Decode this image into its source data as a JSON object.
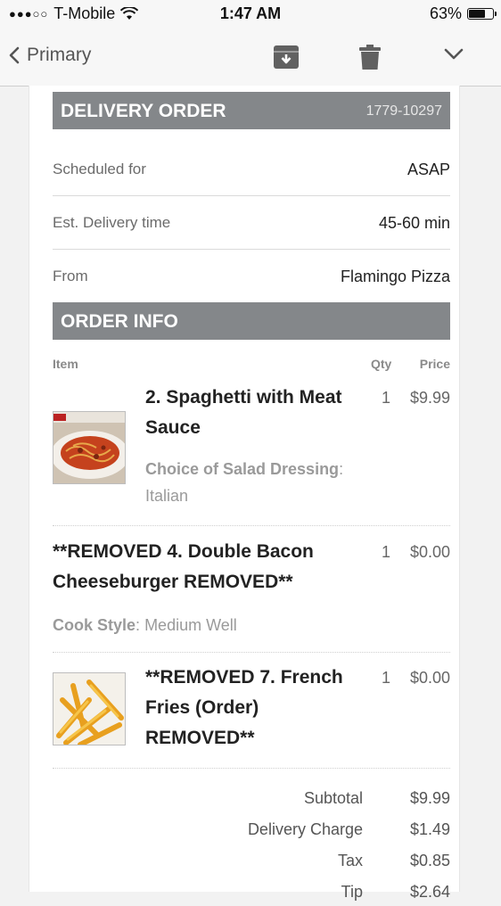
{
  "status": {
    "signal_dots": "●●●○○",
    "carrier": "T-Mobile",
    "time": "1:47 AM",
    "battery": "63%",
    "battery_level": 0.63
  },
  "nav": {
    "back_label": "Primary",
    "icons": [
      "chevron-left-icon",
      "archive-icon",
      "trash-icon",
      "chevron-down-icon"
    ]
  },
  "delivery": {
    "title": "DELIVERY ORDER",
    "order_number": "1779-10297",
    "rows": [
      {
        "label": "Scheduled for",
        "value": "ASAP"
      },
      {
        "label": "Est. Delivery time",
        "value": "45-60 min"
      },
      {
        "label": "From",
        "value": "Flamingo Pizza"
      }
    ]
  },
  "order_info": {
    "title": "ORDER INFO",
    "columns": {
      "item": "Item",
      "qty": "Qty",
      "price": "Price"
    },
    "items": [
      {
        "name_line1": "2. Spaghetti with Meat",
        "name_line2": "Sauce",
        "qty": "1",
        "price": "$9.99",
        "option_label": "Choice of Salad Dressing",
        "option_sep": ":",
        "option_value": "Italian",
        "image": "spaghetti-photo"
      },
      {
        "name_line1": "**REMOVED 4. Double Bacon",
        "name_line2": "Cheeseburger REMOVED**",
        "qty": "1",
        "price": "$0.00",
        "option_label": "Cook Style",
        "option_sep": ":",
        "option_value": "Medium Well"
      },
      {
        "name_line1": "**REMOVED 7. French",
        "name_line2": "Fries (Order)",
        "name_line3": "REMOVED**",
        "qty": "1",
        "price": "$0.00",
        "image": "fries-photo"
      }
    ]
  },
  "totals": [
    {
      "label": "Subtotal",
      "value": "$9.99"
    },
    {
      "label": "Delivery Charge",
      "value": "$1.49"
    },
    {
      "label": "Tax",
      "value": "$0.85"
    },
    {
      "label": "Tip",
      "value": "$2.64"
    }
  ],
  "colors": {
    "header_band": "#84878a",
    "page_bg": "#f2f2f2",
    "text_muted": "#9a9a9a"
  }
}
